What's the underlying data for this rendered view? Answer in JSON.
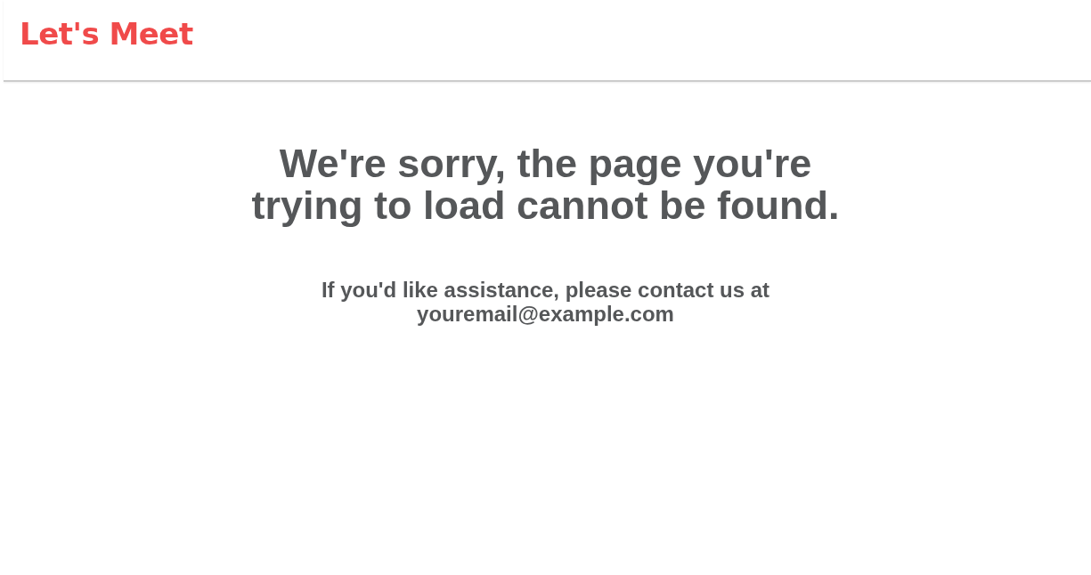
{
  "header": {
    "logo": "Let's Meet"
  },
  "error": {
    "heading": "We're sorry, the page you're trying to load cannot be found.",
    "message": "If you'd like assistance, please contact us at youremail@example.com"
  }
}
